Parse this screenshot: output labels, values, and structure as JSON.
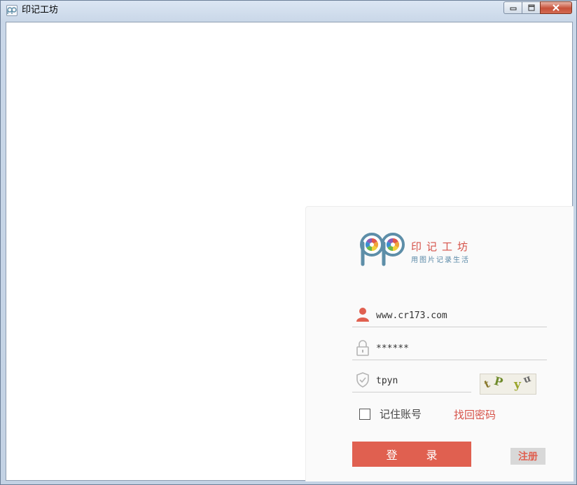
{
  "window": {
    "title": "印记工坊",
    "controls": {
      "minimize": "▭",
      "maximize": "□",
      "close": "✕"
    }
  },
  "brand": {
    "name": "印记工坊",
    "slogan": "用图片记录生活",
    "colors": {
      "accent": "#e06050",
      "slogan": "#5b8aa8",
      "logo_stroke": "#5d8ea8"
    }
  },
  "login": {
    "username": {
      "value": "www.cr173.com",
      "icon": "user-icon"
    },
    "password": {
      "value": "******",
      "icon": "lock-icon"
    },
    "captcha": {
      "value": "tpyn",
      "image_text": "tPyn",
      "icon": "shield-icon"
    },
    "remember_label": "记住账号",
    "remember_checked": false,
    "forgot_label": "找回密码",
    "login_label": "登 录",
    "register_label": "注册"
  }
}
